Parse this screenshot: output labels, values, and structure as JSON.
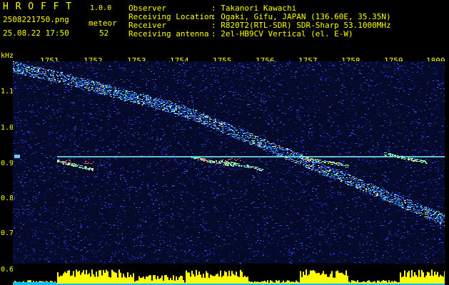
{
  "app": {
    "title": "H R O F F T",
    "version": "1.0.0"
  },
  "file": {
    "name": "2508221750.png",
    "datetime": "25.08.22 17:50"
  },
  "meteor": {
    "label": "meteor",
    "count": "52"
  },
  "info": [
    {
      "label": "Observer",
      "value": ": Takanori Kawachi"
    },
    {
      "label": "Receiving Location",
      "value": ": Ogaki, Gifu, JAPAN (136.60E, 35.35N)"
    },
    {
      "label": "Receiver",
      "value": ": R820T2(RTL-SDR) SDR-Sharp 53.1000MHz"
    },
    {
      "label": "Receiving antenna",
      "value": ": 2el-HB9CV Vertical (el. E-W)"
    }
  ],
  "axis": {
    "y_unit": "kHz",
    "y_labels": [
      "1.1",
      "1.0",
      "0.9",
      "0.8",
      "0.7",
      "0.6"
    ],
    "x_labels": [
      "1751",
      "1752",
      "1753",
      "1754",
      "1755",
      "1756",
      "1757",
      "1758",
      "1759",
      "1800"
    ]
  },
  "colors": {
    "header_text": "#ffff00",
    "plot_background": "#050a2a",
    "noise_blue": "#1a3cff",
    "trace_cyan": "#33ffff",
    "bottom_bar": "#ffff00"
  }
}
